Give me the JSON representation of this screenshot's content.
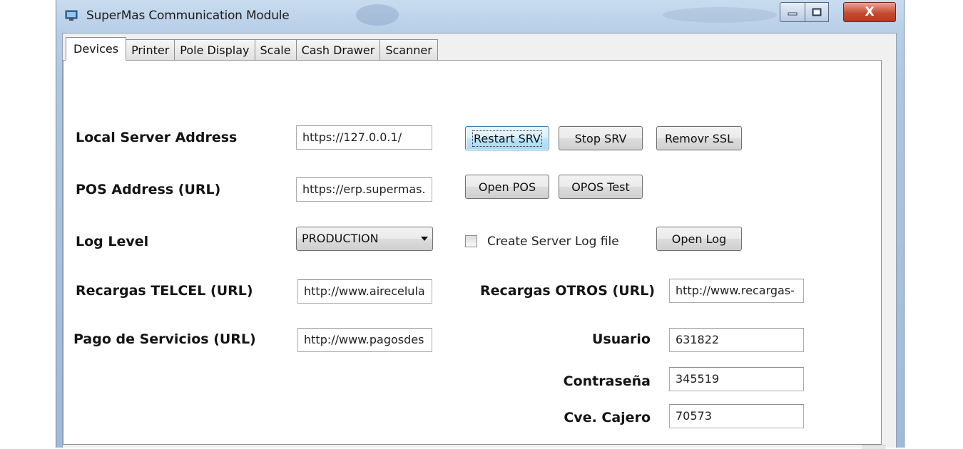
{
  "window": {
    "title": "SuperMas Communication Module",
    "close_glyph": "X",
    "accent": "#c64a32"
  },
  "tabs": [
    {
      "label": "Devices",
      "active": true
    },
    {
      "label": "Printer"
    },
    {
      "label": "Pole Display"
    },
    {
      "label": "Scale"
    },
    {
      "label": "Cash Drawer"
    },
    {
      "label": "Scanner"
    }
  ],
  "devices": {
    "local_server": {
      "label": "Local Server Address",
      "value": "https://127.0.0.1/"
    },
    "pos_address": {
      "label": "POS Address (URL)",
      "value": "https://erp.supermas."
    },
    "log_level": {
      "label": "Log Level",
      "selected": "PRODUCTION"
    },
    "telcel": {
      "label": "Recargas TELCEL (URL)",
      "value": "http://www.airecelula"
    },
    "pago": {
      "label": "Pago de Servicios (URL)",
      "value": "http://www.pagosdes"
    },
    "otros": {
      "label": "Recargas OTROS (URL)",
      "value": "http://www.recargas-"
    },
    "usuario": {
      "label": "Usuario",
      "value": "631822"
    },
    "contrasena": {
      "label": "Contraseña",
      "value": "345519"
    },
    "cajero": {
      "label": "Cve. Cajero",
      "value": "70573"
    },
    "buttons": {
      "restart": "Restart SRV",
      "stop": "Stop SRV",
      "remove_ssl": "Removr SSL",
      "open_pos": "Open POS",
      "opos_test": "OPOS Test",
      "open_log": "Open Log"
    },
    "create_log": {
      "label": "Create Server Log file",
      "checked": false
    }
  }
}
